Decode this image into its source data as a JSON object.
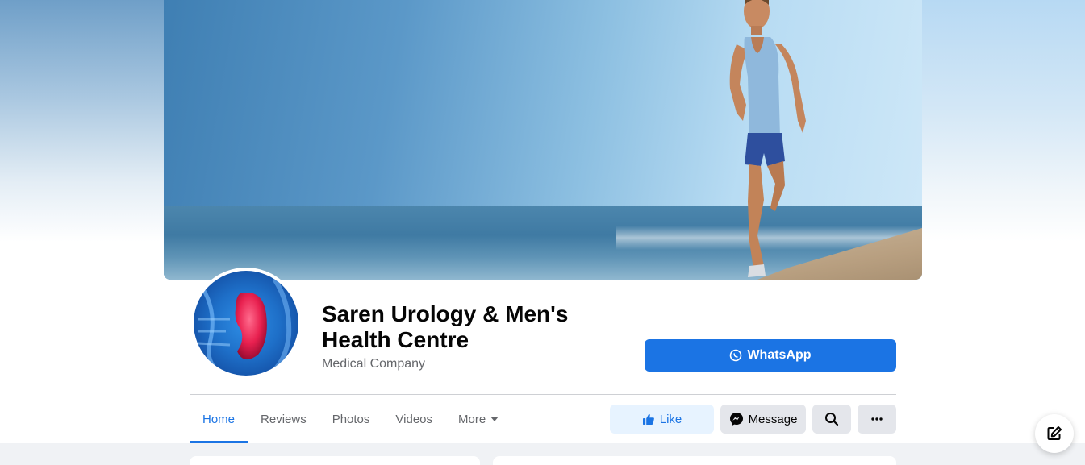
{
  "page": {
    "name": "Saren Urology & Men's Health Centre",
    "category": "Medical Company"
  },
  "cta": {
    "whatsapp_label": "WhatsApp"
  },
  "tabs": [
    {
      "label": "Home",
      "active": true
    },
    {
      "label": "Reviews",
      "active": false
    },
    {
      "label": "Photos",
      "active": false
    },
    {
      "label": "Videos",
      "active": false
    },
    {
      "label": "More",
      "active": false
    }
  ],
  "actions": {
    "like_label": "Like",
    "message_label": "Message",
    "search_icon": "search-icon",
    "more_icon": "ellipsis-icon"
  },
  "colors": {
    "accent": "#1b74e4",
    "like_bg": "#e7f3ff",
    "secondary_bg": "#e4e6eb",
    "muted_text": "#65676b"
  }
}
